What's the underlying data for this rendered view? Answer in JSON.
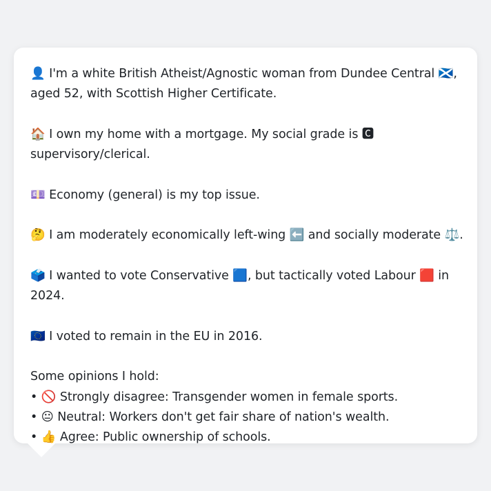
{
  "persona": {
    "identity": "👤 I'm a white British Atheist/Agnostic woman from Dundee Central 🏴󠁧󠁢󠁳󠁣󠁴󠁿, aged 52, with Scottish Higher Certificate.",
    "home": "🏠 I own my home with a mortgage. My social grade is 🅲 supervisory/clerical.",
    "issue": "💷 Economy (general) is my top issue.",
    "ideology": "🤔 I am moderately economically left-wing ⬅️ and socially moderate ⚖️.",
    "vote": "🗳️ I wanted to vote Conservative 🟦, but tactically voted Labour 🟥 in 2024.",
    "eu": "🇪🇺 I voted to remain in the EU in 2016.",
    "opinions_heading": "Some opinions I hold:",
    "opinions": [
      "• 🚫 Strongly disagree: Transgender women in female sports.",
      "• 😐 Neutral: Workers don't get fair share of nation's wealth.",
      "• 👍 Agree: Public ownership of schools."
    ]
  }
}
